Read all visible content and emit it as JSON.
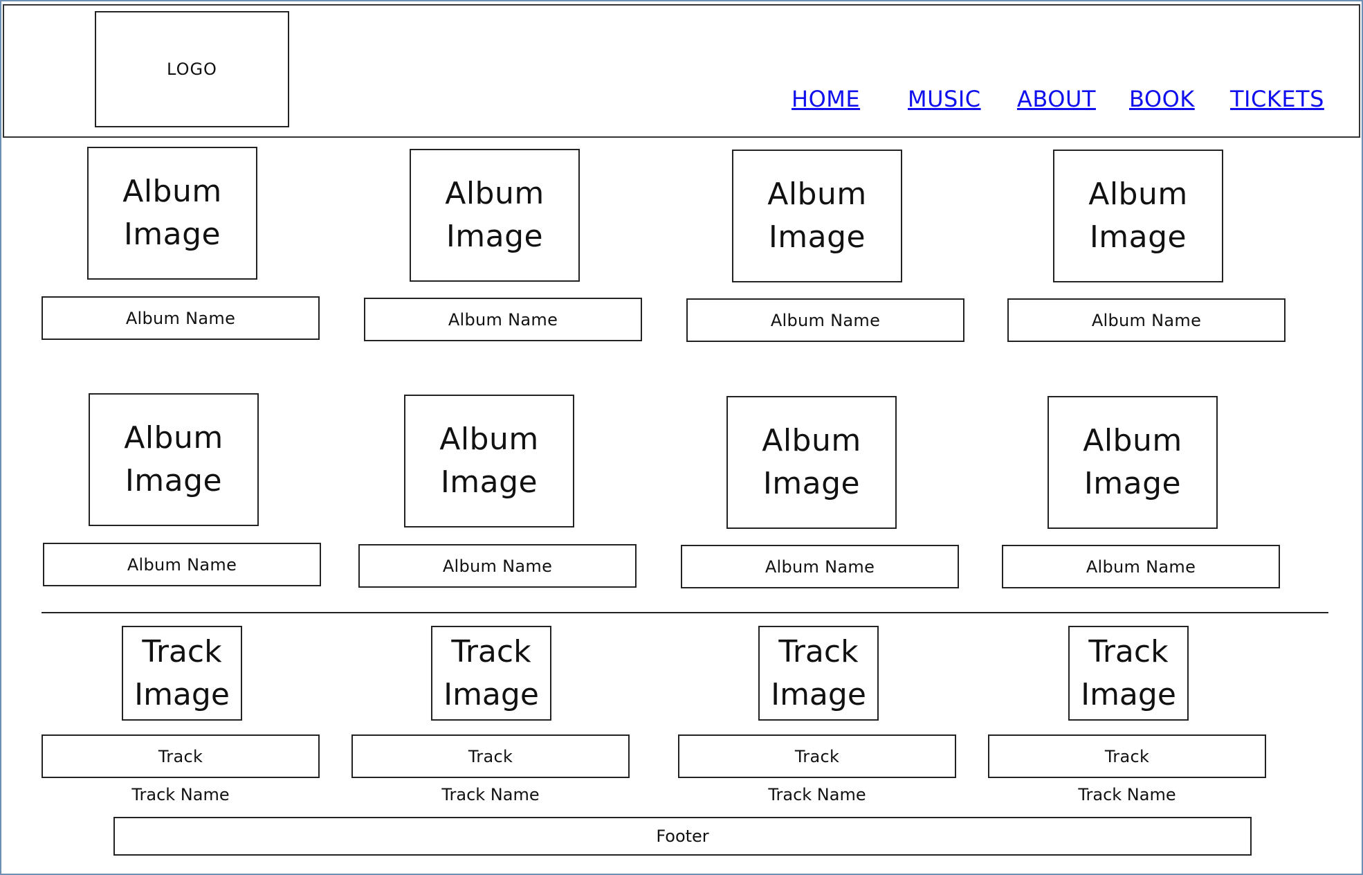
{
  "header": {
    "logo": "LOGO",
    "nav": [
      {
        "label": "HOME"
      },
      {
        "label": "MUSIC"
      },
      {
        "label": "ABOUT"
      },
      {
        "label": "BOOK"
      },
      {
        "label": "TICKETS"
      }
    ]
  },
  "albums": [
    {
      "image_label": [
        "Album",
        "Image"
      ],
      "name": "Album Name"
    },
    {
      "image_label": [
        "Album",
        "Image"
      ],
      "name": "Album Name"
    },
    {
      "image_label": [
        "Album",
        "Image"
      ],
      "name": "Album Name"
    },
    {
      "image_label": [
        "Album",
        "Image"
      ],
      "name": "Album Name"
    },
    {
      "image_label": [
        "Album",
        "Image"
      ],
      "name": "Album Name"
    },
    {
      "image_label": [
        "Album",
        "Image"
      ],
      "name": "Album Name"
    },
    {
      "image_label": [
        "Album",
        "Image"
      ],
      "name": "Album Name"
    },
    {
      "image_label": [
        "Album",
        "Image"
      ],
      "name": "Album Name"
    }
  ],
  "tracks": [
    {
      "image_label": [
        "Track",
        "Image"
      ],
      "track": "Track",
      "track_name": "Track Name"
    },
    {
      "image_label": [
        "Track",
        "Image"
      ],
      "track": "Track",
      "track_name": "Track Name"
    },
    {
      "image_label": [
        "Track",
        "Image"
      ],
      "track": "Track",
      "track_name": "Track Name"
    },
    {
      "image_label": [
        "Track",
        "Image"
      ],
      "track": "Track",
      "track_name": "Track Name"
    }
  ],
  "footer": {
    "label": "Footer"
  }
}
